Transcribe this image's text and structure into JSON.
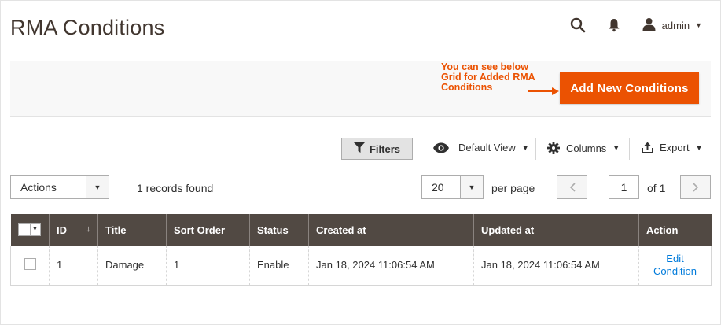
{
  "header": {
    "title": "RMA Conditions",
    "user": "admin"
  },
  "actions_bar": {
    "annotation": "You can see below Grid for Added RMA Conditions",
    "add_button": "Add New Conditions"
  },
  "toolbar": {
    "filters": "Filters",
    "default_view": "Default View",
    "columns": "Columns",
    "export": "Export"
  },
  "grid_controls": {
    "actions_select": "Actions",
    "records_found": "1 records found",
    "page_size": "20",
    "per_page_label": "per page",
    "current_page": "1",
    "of_pages": "of 1"
  },
  "table": {
    "columns": [
      "ID",
      "Title",
      "Sort Order",
      "Status",
      "Created at",
      "Updated at",
      "Action"
    ],
    "rows": [
      {
        "id": "1",
        "title": "Damage",
        "sort_order": "1",
        "status": "Enable",
        "created_at": "Jan 18, 2024 11:06:54 AM",
        "updated_at": "Jan 18, 2024 11:06:54 AM",
        "action": "Edit Condition"
      }
    ]
  },
  "colors": {
    "accent": "#eb5202",
    "header_bg": "#514943",
    "link": "#007bdb"
  },
  "icons": [
    "search-icon",
    "bell-icon",
    "user-icon",
    "filter-icon",
    "eye-icon",
    "gear-icon",
    "export-icon",
    "chevron-left-icon",
    "chevron-right-icon",
    "chevron-down-icon",
    "sort-arrow-icon"
  ]
}
